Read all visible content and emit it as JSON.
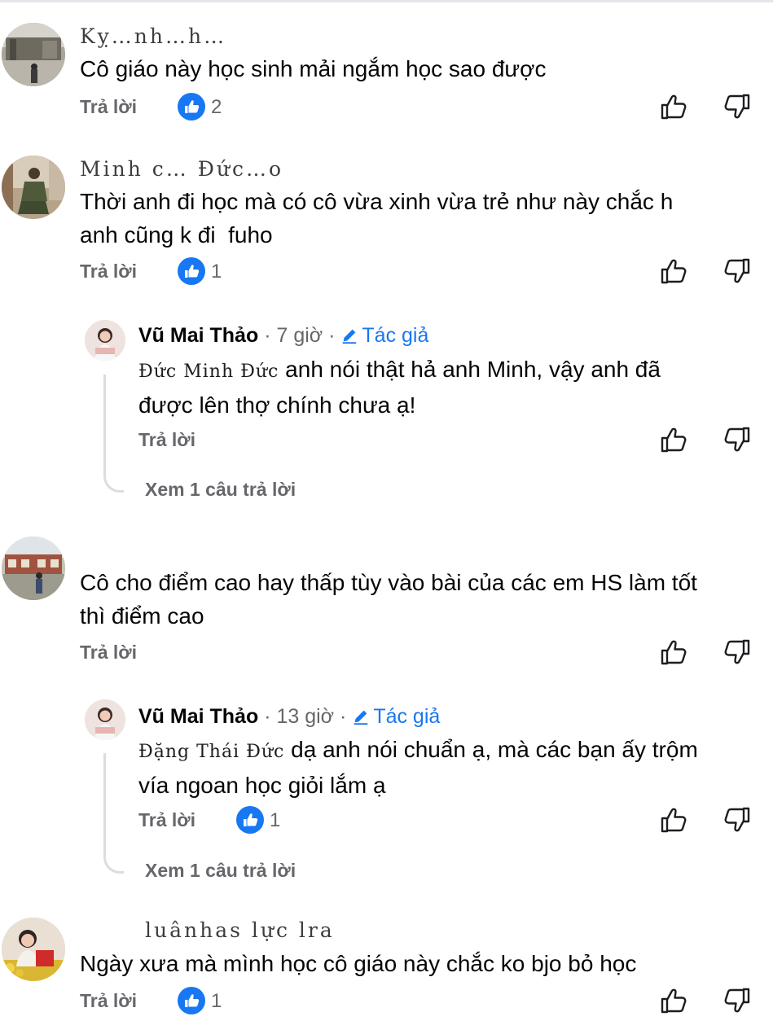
{
  "comments": [
    {
      "author": "Kỵ…nh…h…",
      "text": "Cô giáo này học sinh mải ngắm học sao được",
      "reply_label": "Trả lời",
      "like_count": "2"
    },
    {
      "author": "Minh  c…  Đức…o",
      "text": "Thời anh đi học mà có cô vừa xinh vừa trẻ như này chắc h\nanh cũng k đi  fuho",
      "reply_label": "Trả lời",
      "like_count": "1",
      "reply": {
        "author": "Vũ Mai Thảo",
        "time": "7 giờ",
        "author_badge": "Tác giả",
        "mention": "Đức Minh Đức",
        "text": "anh nói thật hả anh Minh, vậy anh đã\nđược lên thợ chính chưa ạ!",
        "reply_label": "Trả lời",
        "more_replies": "Xem 1 câu trả lời"
      }
    },
    {
      "author": "",
      "text": "Cô cho điểm cao hay thấp tùy vào bài của các em HS làm tốt\nthì điểm cao",
      "reply_label": "Trả lời",
      "reply": {
        "author": "Vũ Mai Thảo",
        "time": "13 giờ",
        "author_badge": "Tác giả",
        "mention": "Đặng Thái Đức",
        "text": "dạ anh nói chuẩn ạ, mà các bạn ấy trộm\nvía ngoan học giỏi lắm ạ",
        "reply_label": "Trả lời",
        "like_count": "1",
        "more_replies": "Xem 1 câu trả lời"
      }
    },
    {
      "author": "luânhas lực   lra",
      "text": "Ngày xưa mà mình học cô giáo này chắc ko bjo bỏ học",
      "reply_label": "Trả lời",
      "like_count": "1"
    }
  ],
  "separator": "·",
  "icons": {
    "like": "thumbs-up-icon",
    "dislike": "thumbs-down-icon",
    "badge": "like-badge-icon",
    "author": "pencil-icon"
  },
  "colors": {
    "accent": "#1877f2",
    "muted": "#65676b",
    "text": "#050505"
  }
}
